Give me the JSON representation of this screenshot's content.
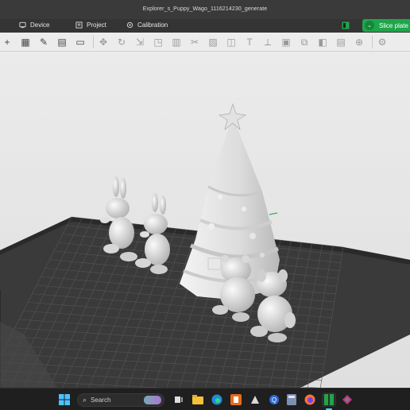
{
  "window": {
    "title": "Explorer_s_Puppy_Wago_1116214230_generate"
  },
  "menubar": {
    "items": [
      {
        "label": "Device",
        "icon": "device-icon"
      },
      {
        "label": "Project",
        "icon": "project-icon"
      },
      {
        "label": "Calibration",
        "icon": "calibration-icon"
      }
    ],
    "slice_label": "Slice plate",
    "accent": "#1fa54a"
  },
  "toolbar": {
    "icons": [
      "add-icon",
      "grid-icon",
      "edit-icon",
      "layout-icon",
      "plate-icon",
      "move-icon",
      "rotate-icon",
      "scale-icon",
      "lay-on-face-icon",
      "split-icon",
      "cut-icon",
      "support-paint-icon",
      "seam-paint-icon",
      "text-icon",
      "measure-icon",
      "assembly-icon",
      "arrange-icon",
      "orient-icon",
      "variable-layer-icon",
      "mesh-boolean-icon",
      "settings-icon"
    ]
  },
  "taskbar": {
    "search_placeholder": "Search",
    "apps": [
      "windows-start-icon",
      "search-icon",
      "weather-widget-icon",
      "task-view-icon",
      "file-explorer-icon",
      "edge-icon",
      "slicer-app-icon",
      "cura-icon",
      "explorer-alt-icon",
      "calculator-icon",
      "firefox-icon",
      "bambu-studio-icon",
      "bambu-alt-icon"
    ]
  },
  "scene": {
    "models": [
      "christmas-tree",
      "bunny-left",
      "bunny-right",
      "bear-cub",
      "puppy"
    ],
    "plate_color": "#3a3a3a",
    "model_color": "#e4e4e4"
  }
}
